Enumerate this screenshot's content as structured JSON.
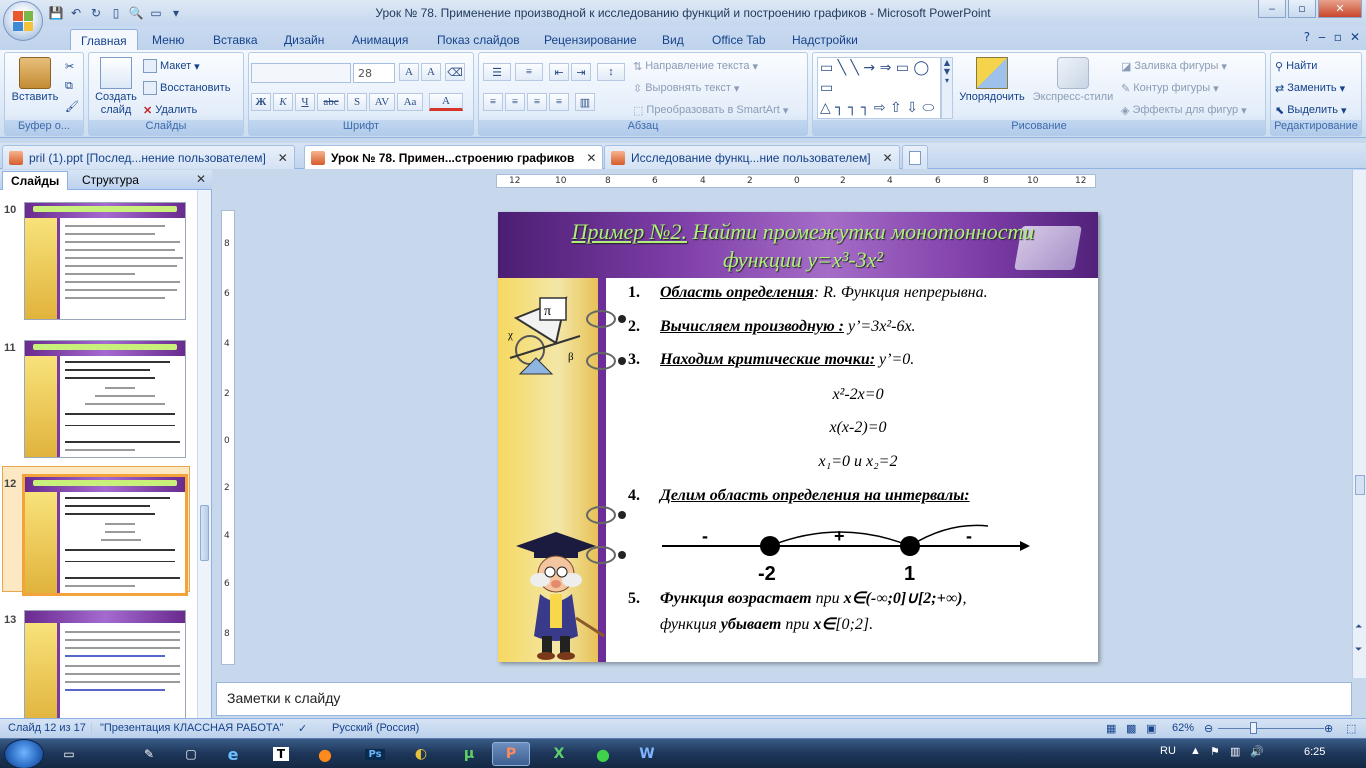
{
  "window": {
    "title": "Урок № 78. Применение производной к исследованию функций и построению графиков - Microsoft PowerPoint",
    "min": "‒",
    "max": "▫",
    "close": "✕"
  },
  "ribbon_tabs": [
    "Главная",
    "Меню",
    "Вставка",
    "Дизайн",
    "Анимация",
    "Показ слайдов",
    "Рецензирование",
    "Вид",
    "Office Tab",
    "Надстройки"
  ],
  "ribbon": {
    "clipboard": {
      "paste": "Вставить",
      "label": "Буфер о..."
    },
    "slides": {
      "create": "Создать слайд",
      "layout": "Макет",
      "reset": "Восстановить",
      "delete": "Удалить",
      "label": "Слайды"
    },
    "font": {
      "size": "28",
      "bold": "Ж",
      "italic": "К",
      "underline": "Ч",
      "strike": "abc",
      "shadow": "S",
      "spacing": "AV",
      "case": "Aa",
      "color": "A",
      "grow": "A",
      "shrink": "A",
      "label": "Шрифт"
    },
    "paragraph": {
      "text_direction": "Направление текста",
      "align_text": "Выровнять текст",
      "smartart": "Преобразовать в SmartArt",
      "label": "Абзац"
    },
    "drawing": {
      "arrange": "Упорядочить",
      "quick_styles": "Экспресс-стили",
      "fill": "Заливка фигуры",
      "outline": "Контур фигуры",
      "effects": "Эффекты для фигур",
      "label": "Рисование"
    },
    "editing": {
      "find": "Найти",
      "replace": "Заменить",
      "select": "Выделить",
      "label": "Редактирование"
    }
  },
  "doc_tabs": [
    {
      "label": "pril (1).ppt [Послед...нение пользователем]"
    },
    {
      "label": "Урок № 78. Примен...строению графиков"
    },
    {
      "label": "Исследование функц...ние пользователем]"
    }
  ],
  "left_pane": {
    "tabs": [
      "Слайды",
      "Структура"
    ],
    "close": "✕",
    "slides": [
      "10",
      "11",
      "12",
      "13"
    ]
  },
  "ruler": {
    "h": [
      "12",
      "10",
      "8",
      "6",
      "4",
      "2",
      "0",
      "2",
      "4",
      "6",
      "8",
      "10",
      "12"
    ],
    "v": [
      "8",
      "6",
      "4",
      "2",
      "0",
      "2",
      "4",
      "6",
      "8"
    ]
  },
  "slide": {
    "title_underlined": "Пример №2.",
    "title_rest": " Найти промежутки монотонности",
    "title_line2": "функции y=x³-3x²",
    "items": [
      {
        "num": "1.",
        "bold": "Область определения",
        "text": ": R. Функция непрерывна."
      },
      {
        "num": "2.",
        "bold": "Вычисляем производную :",
        "text": " y’=3x²-6x."
      },
      {
        "num": "3.",
        "bold": "Находим критические точки:",
        "text": " y’=0."
      },
      {
        "num": "4.",
        "bold": "Делим область определения на интервалы:",
        "text": ""
      }
    ],
    "eq1": "x²-2x=0",
    "eq2": "x(x-2)=0",
    "eq3": "x₁=0 и x₂=2",
    "signs": [
      "-",
      "+",
      "-"
    ],
    "points": [
      "-2",
      "1"
    ],
    "item5": {
      "num": "5.",
      "p1_bold": "Функция возрастает",
      "p1_text": " при ",
      "p1_bold2": "x∈(-∞;0]∪[2;+∞)",
      "p1_end": ",",
      "p2_text": "функция ",
      "p2_bold": "убывает",
      "p2_text2": " при ",
      "p2_bold2": "x∈",
      "p2_end": "[0;2]."
    }
  },
  "notes": {
    "placeholder": "Заметки к слайду"
  },
  "status": {
    "slide": "Слайд 12 из 17",
    "theme": "\"Презентация КЛАССНАЯ РАБОТА\"",
    "lang": "Русский (Россия)",
    "zoom": "62%",
    "zoom_fraction": 0.62
  },
  "taskbar": {
    "lang": "RU",
    "time": "6:25"
  },
  "colors": {
    "ribbon_text": "#15428b",
    "slide_title": "#aef07a",
    "slide_header": "#7e3ea8",
    "selection": "#f4a23c"
  }
}
